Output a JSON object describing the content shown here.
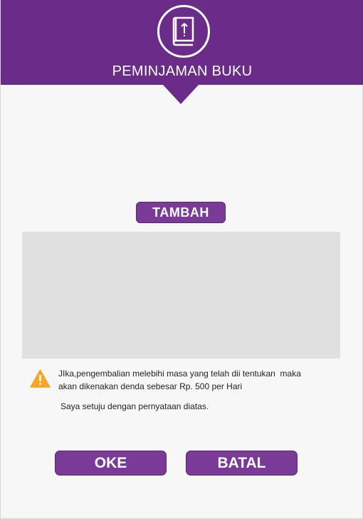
{
  "header": {
    "title": "PEMINJAMAN BUKU",
    "icon": "book-upload-icon"
  },
  "actions": {
    "add_label": "TAMBAH",
    "ok_label": "OKE",
    "cancel_label": "BATAL"
  },
  "notice": {
    "warning_line1": "JIka,pengembalian melebihi masa yang telah dii tentukan  maka",
    "warning_line2": "akan dikenakan denda sebesar Rp. 500 per Hari",
    "agreement": "Saya setuju dengan pernyataan diatas.",
    "icon": "warning-icon"
  },
  "colors": {
    "primary": "#6b2c89",
    "button": "#7a3a97",
    "warning": "#f5a623",
    "list_bg": "#e0e0e0"
  }
}
